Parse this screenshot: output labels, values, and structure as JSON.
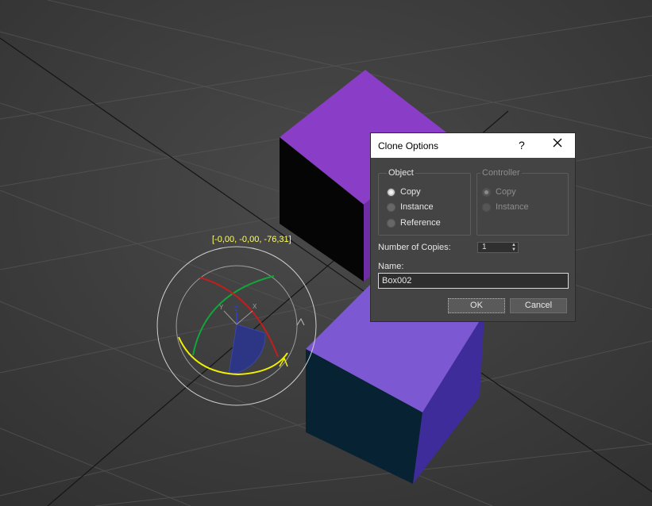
{
  "viewport": {
    "coordinate_readout": "[-0,00, -0,00, -76,31]",
    "gizmo_axis_z": "Z",
    "gizmo_axis_x": "X",
    "gizmo_axis_y": "Y",
    "colors": {
      "background": "#3b3b3b",
      "box_top": "#8a3dc6",
      "box_side_blue": "#7c58d2",
      "box_dark_side": "#062233",
      "readout": "#ffff66"
    }
  },
  "dialog": {
    "title": "Clone Options",
    "help": "?",
    "object_group": {
      "label": "Object",
      "options": [
        {
          "label": "Copy",
          "selected": true
        },
        {
          "label": "Instance",
          "selected": false
        },
        {
          "label": "Reference",
          "selected": false
        }
      ]
    },
    "controller_group": {
      "label": "Controller",
      "options": [
        {
          "label": "Copy",
          "selected": true,
          "disabled": true
        },
        {
          "label": "Instance",
          "selected": false,
          "disabled": true
        }
      ]
    },
    "number_of_copies_label": "Number of Copies:",
    "number_of_copies_value": "1",
    "name_label": "Name:",
    "name_value": "Box002",
    "ok_label": "OK",
    "cancel_label": "Cancel"
  }
}
